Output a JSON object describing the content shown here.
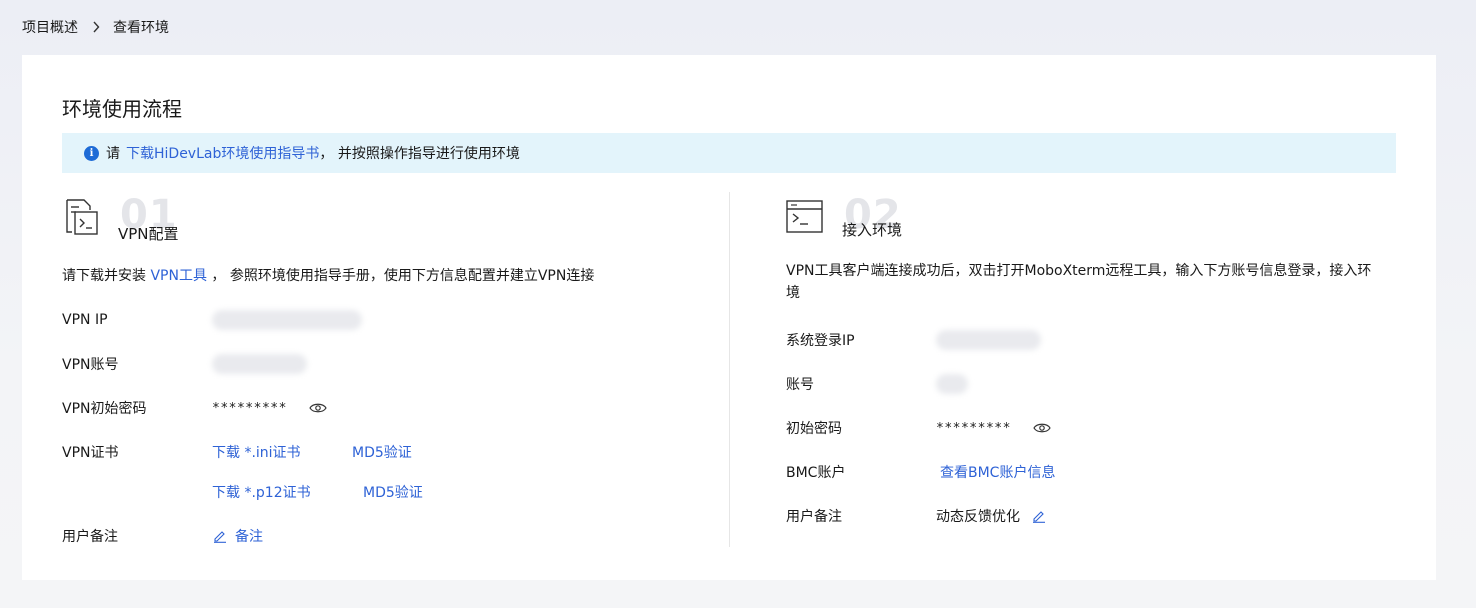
{
  "breadcrumb": {
    "items": [
      "项目概述",
      "查看环境"
    ]
  },
  "page": {
    "title": "环境使用流程"
  },
  "notice": {
    "prefix": "请",
    "link": "下载HiDevLab环境使用指导书",
    "suffix": "， 并按照操作指导进行使用环境"
  },
  "step1": {
    "number": "01",
    "label": "VPN配置",
    "desc_prefix": "请下载并安装",
    "desc_link": "VPN工具",
    "desc_suffix": "， 参照环境使用指导手册，使用下方信息配置并建立VPN连接",
    "fields": {
      "vpn_ip_label": "VPN IP",
      "vpn_account_label": "VPN账号",
      "vpn_password_label": "VPN初始密码",
      "vpn_password_value": "*********",
      "vpn_cert_label": "VPN证书",
      "cert_ini_link": "下载 *.ini证书",
      "cert_ini_md5": "MD5验证",
      "cert_p12_link": "下载 *.p12证书",
      "cert_p12_md5": "MD5验证",
      "remark_label": "用户备注",
      "remark_link": "备注"
    }
  },
  "step2": {
    "number": "02",
    "label": "接入环境",
    "desc": "VPN工具客户端连接成功后，双击打开MoboXterm远程工具，输入下方账号信息登录，接入环境",
    "fields": {
      "login_ip_label": "系统登录IP",
      "account_label": "账号",
      "password_label": "初始密码",
      "password_value": "*********",
      "bmc_label": "BMC账户",
      "bmc_link": "查看BMC账户信息",
      "remark_label": "用户备注",
      "remark_value": "动态反馈优化"
    }
  },
  "colors": {
    "link": "#2e62d6",
    "notice_bg": "#e3f4fb",
    "info_icon": "#1e6bd6",
    "step_number": "#e4e5e9"
  }
}
